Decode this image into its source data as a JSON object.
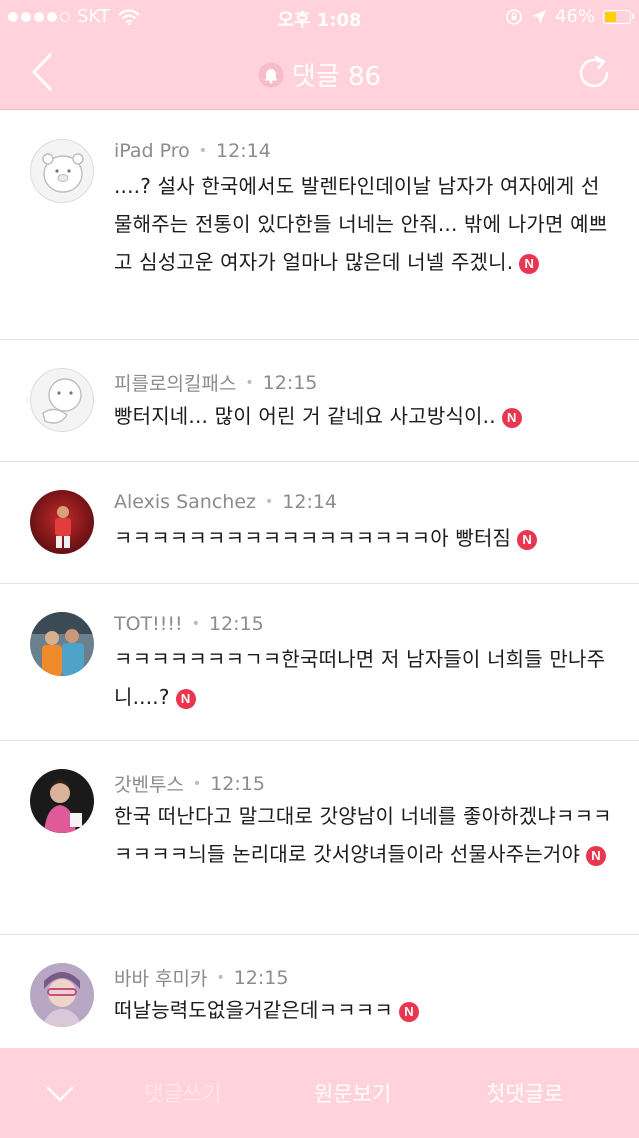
{
  "status_bar": {
    "carrier": "SKT",
    "time": "오후 1:08",
    "battery": "46%",
    "battery_level": 0.46,
    "battery_color": "#ffd100"
  },
  "header": {
    "title": "댓글 86",
    "back_icon": "chevron-left-icon",
    "bell_icon": "bell-icon",
    "refresh_icon": "refresh-icon"
  },
  "comments": [
    {
      "author": "iPad Pro",
      "time": "12:14",
      "text": "....? 설사 한국에서도 발렌타인데이날 남자가 여자에게 선물해주는 전통이 있다한들 너네는 안줘... 밖에 나가면 예쁘고 심성고운 여자가 얼마나 많은데 너넬 주겠니.",
      "badge": "N"
    },
    {
      "author": "피를로의킬패스",
      "time": "12:15",
      "text": "빵터지네... 많이 어린 거 같네요 사고방식이..",
      "badge": "N"
    },
    {
      "author": "Alexis Sanchez",
      "time": "12:14",
      "text": "ㅋㅋㅋㅋㅋㅋㅋㅋㅋㅋㅋㅋㅋㅋㅋㅋㅋ아 빵터짐",
      "badge": "N"
    },
    {
      "author": "TOT!!!!",
      "time": "12:15",
      "text": "ㅋㅋㅋㅋㅋㅋㅋㄱㅋ한국떠나면 저 남자들이 너희들 만나주니....?",
      "badge": "N"
    },
    {
      "author": "갓벤투스",
      "time": "12:15",
      "text": "한국 떠난다고 말그대로 갓양남이 너네를 좋아하겠냐ㅋㅋㅋㅋㅋㅋㅋ늬들 논리대로 갓서양녀들이라 선물사주는거야",
      "badge": "N"
    },
    {
      "author": "바바 후미카",
      "time": "12:15",
      "text": "떠날능력도없을거같은데ㅋㅋㅋㅋ",
      "badge": "N"
    }
  ],
  "footer": {
    "collapse_icon": "chevron-down-icon",
    "write_label": "댓글쓰기",
    "original_label": "원문보기",
    "first_label": "첫댓글로"
  },
  "colors": {
    "accent": "#ffd2dc",
    "badge": "#e8364f"
  }
}
